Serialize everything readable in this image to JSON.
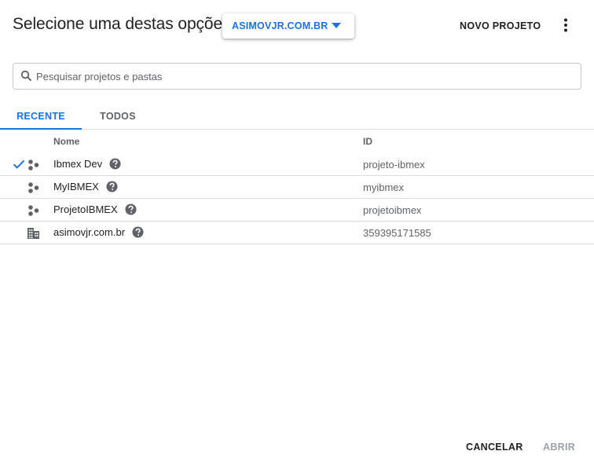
{
  "dialog": {
    "title": "Selecione uma destas opções",
    "organization": "ASIMOVJR.COM.BR",
    "new_project_label": "NOVO PROJETO"
  },
  "search": {
    "placeholder": "Pesquisar projetos e pastas",
    "value": ""
  },
  "tabs": [
    {
      "label": "RECENTE",
      "active": true
    },
    {
      "label": "TODOS",
      "active": false
    }
  ],
  "table": {
    "columns": {
      "name": "Nome",
      "id": "ID"
    },
    "rows": [
      {
        "name": "Ibmex Dev",
        "id": "projeto-ibmex",
        "type": "project-icon",
        "selected": true
      },
      {
        "name": "MyIBMEX",
        "id": "myibmex",
        "type": "project-icon",
        "selected": false
      },
      {
        "name": "ProjetoIBMEX",
        "id": "projetoibmex",
        "type": "project-icon",
        "selected": false
      },
      {
        "name": "asimovjr.com.br",
        "id": "359395171585",
        "type": "organization-icon",
        "selected": false
      }
    ]
  },
  "footer": {
    "cancel_label": "CANCELAR",
    "open_label": "ABRIR"
  },
  "colors": {
    "accent": "#1a73e8",
    "text": "#202124",
    "secondary": "#5f6368",
    "disabled": "#9aa0a6",
    "divider": "#dadce0"
  }
}
